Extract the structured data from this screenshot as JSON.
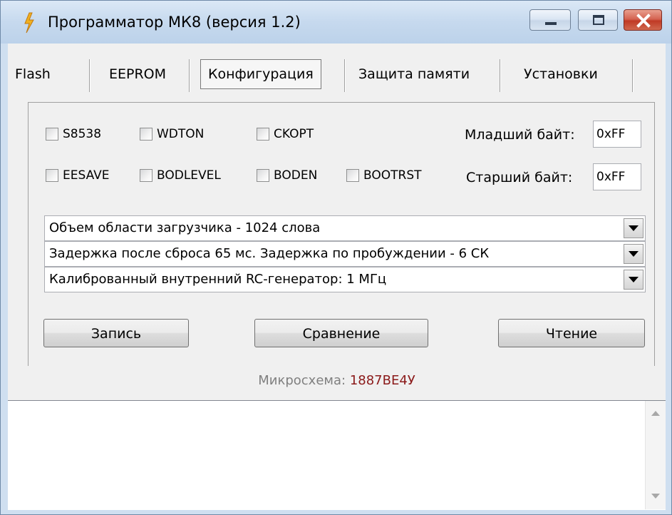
{
  "window": {
    "title": "Программатор МК8 (версия 1.2)",
    "icon": "lightning-icon",
    "controls": [
      "minimize-icon",
      "maximize-icon",
      "close-icon"
    ]
  },
  "tabs": [
    {
      "label": "Flash",
      "selected": false
    },
    {
      "label": "EEPROM",
      "selected": false
    },
    {
      "label": "Конфигурация",
      "selected": true
    },
    {
      "label": "Защита памяти",
      "selected": false
    },
    {
      "label": "Установки",
      "selected": false
    }
  ],
  "fuses": {
    "row1": [
      {
        "label": "S8538",
        "checked": false
      },
      {
        "label": "WDTON",
        "checked": false
      },
      {
        "label": "CKOPT",
        "checked": false
      }
    ],
    "row2": [
      {
        "label": "EESAVE",
        "checked": false
      },
      {
        "label": "BODLEVEL",
        "checked": false
      },
      {
        "label": "BODEN",
        "checked": false
      },
      {
        "label": "BOOTRST",
        "checked": false
      }
    ],
    "low_byte_label": "Младший байт:",
    "low_byte_value": "0xFF",
    "high_byte_label": "Старший байт:",
    "high_byte_value": "0xFF"
  },
  "combos": [
    {
      "value": "Объем области загрузчика - 1024 слова"
    },
    {
      "value": "Задержка после сброса 65 мс. Задержка по пробуждении - 6 СК"
    },
    {
      "value": "Калиброванный внутренний RC-генератор: 1 МГц"
    }
  ],
  "buttons": {
    "write": "Запись",
    "compare": "Сравнение",
    "read": "Чтение"
  },
  "chip": {
    "label": "Микросхема:",
    "value": "1887ВЕ4У"
  },
  "colors": {
    "chip_value": "#8b1a1a",
    "close_button": "#c03a25",
    "title_bar": "#c6d9ee"
  }
}
